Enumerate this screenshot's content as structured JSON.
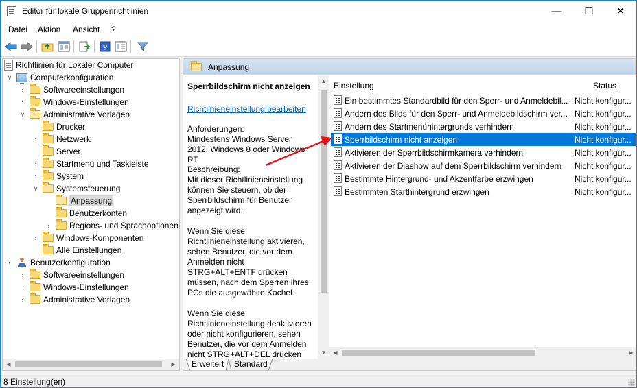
{
  "window": {
    "title": "Editor für lokale Gruppenrichtlinien",
    "caption_minimize": "—",
    "caption_maximize": "☐",
    "caption_close": "✕"
  },
  "menu": {
    "datei": "Datei",
    "aktion": "Aktion",
    "ansicht": "Ansicht",
    "help": "?"
  },
  "toolbar": {
    "icons": [
      "back-icon",
      "forward-icon",
      "up-folder-icon",
      "show-hide-tree-icon",
      "export-list-icon",
      "help-icon",
      "properties-icon",
      "filter-icon"
    ]
  },
  "tree": {
    "root": "Richtlinien für Lokaler Computer",
    "computer": "Computerkonfiguration",
    "c_software": "Softwareeinstellungen",
    "c_windows": "Windows-Einstellungen",
    "c_admin": "Administrative Vorlagen",
    "drucker": "Drucker",
    "netzwerk": "Netzwerk",
    "server": "Server",
    "startmenu": "Startmenü und Taskleiste",
    "system": "System",
    "systemsteuerung": "Systemsteuerung",
    "anpassung": "Anpassung",
    "benutzerkonten": "Benutzerkonten",
    "regionen": "Regions- und Sprachoptionen",
    "windows_komponenten": "Windows-Komponenten",
    "alle": "Alle Einstellungen",
    "benutzer": "Benutzerkonfiguration",
    "u_software": "Softwareeinstellungen",
    "u_windows": "Windows-Einstellungen",
    "u_admin": "Administrative Vorlagen"
  },
  "right": {
    "header": "Anpassung",
    "desc_title": "Sperrbildschirm nicht anzeigen",
    "desc_link": "Richtlinieneinstellung bearbeiten",
    "requirements": "Anforderungen:\nMindestens Windows Server 2012, Windows 8 oder Windows RT",
    "description": "Beschreibung:\nMit dieser Richtlinieneinstellung können Sie steuern, ob der Sperrbildschirm für Benutzer angezeigt wird.",
    "enable_text": "Wenn Sie diese Richtlinieneinstellung aktivieren, sehen Benutzer, die vor dem Anmelden nicht STRG+ALT+ENTF drücken müssen, nach dem Sperren ihres PCs die ausgewählte Kachel.",
    "disable_text": "Wenn Sie diese Richtlinieneinstellung deaktivieren oder nicht konfigurieren, sehen Benutzer, die vor dem Anmelden nicht STRG+ALT+DEL drücken",
    "col_setting": "Einstellung",
    "col_status": "Status",
    "rows": [
      {
        "name": "Ein bestimmtes Standardbild für den Sperr- und Anmeldebil...",
        "status": "Nicht konfigur..."
      },
      {
        "name": "Ändern des Bilds für den Sperr- und Anmeldebildschirm ver...",
        "status": "Nicht konfigur..."
      },
      {
        "name": "Ändern des Startmenühintergrunds verhindern",
        "status": "Nicht konfigur..."
      },
      {
        "name": "Sperrbildschirm nicht anzeigen",
        "status": "Nicht konfigur..."
      },
      {
        "name": "Aktivieren der Sperrbildschirmkamera verhindern",
        "status": "Nicht konfigur..."
      },
      {
        "name": "Aktivieren der Diashow auf dem Sperrbildschirm verhindern",
        "status": "Nicht konfigur..."
      },
      {
        "name": "Bestimmte Hintergrund- und Akzentfarbe erzwingen",
        "status": "Nicht konfigur..."
      },
      {
        "name": "Bestimmten Starthintergrund erzwingen",
        "status": "Nicht konfigur..."
      }
    ],
    "tab_extended": "Erweitert",
    "tab_standard": "Standard"
  },
  "status": {
    "text": "8 Einstellung(en)"
  },
  "colors": {
    "selection": "#0078d7",
    "link": "#0066cc",
    "annotation_arrow": "#e8141b"
  }
}
